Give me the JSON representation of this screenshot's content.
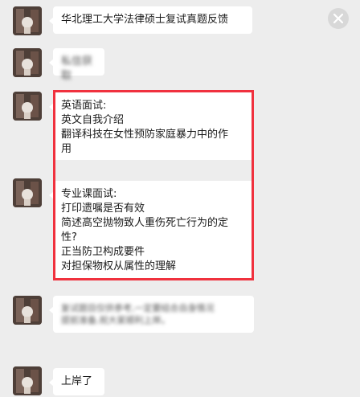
{
  "messages": {
    "m1": "华北理工大学法律硕士复试真题反馈",
    "m2": "私信获取",
    "english": {
      "heading": "英语面试:",
      "lines": [
        "英文自我介绍",
        "翻译科技在女性预防家庭暴力中的作",
        "用"
      ]
    },
    "major": {
      "heading": "专业课面试:",
      "lines": [
        "打印遗嘱是否有效",
        "简述高空抛物致人重伤死亡行为的定",
        "性?",
        "正当防卫构成要件",
        "对担保物权从属性的理解"
      ]
    },
    "m5": [
      "复试题目仅供参考,一定要结合自身情况",
      "提前准备,祝大家顺利上岸。"
    ],
    "m6": "上岸了"
  },
  "colors": {
    "background": "#ededed",
    "bubble": "#ffffff",
    "highlight_border": "#f0313e"
  },
  "icons": {
    "close": "close-icon",
    "avatar": "avatar"
  }
}
